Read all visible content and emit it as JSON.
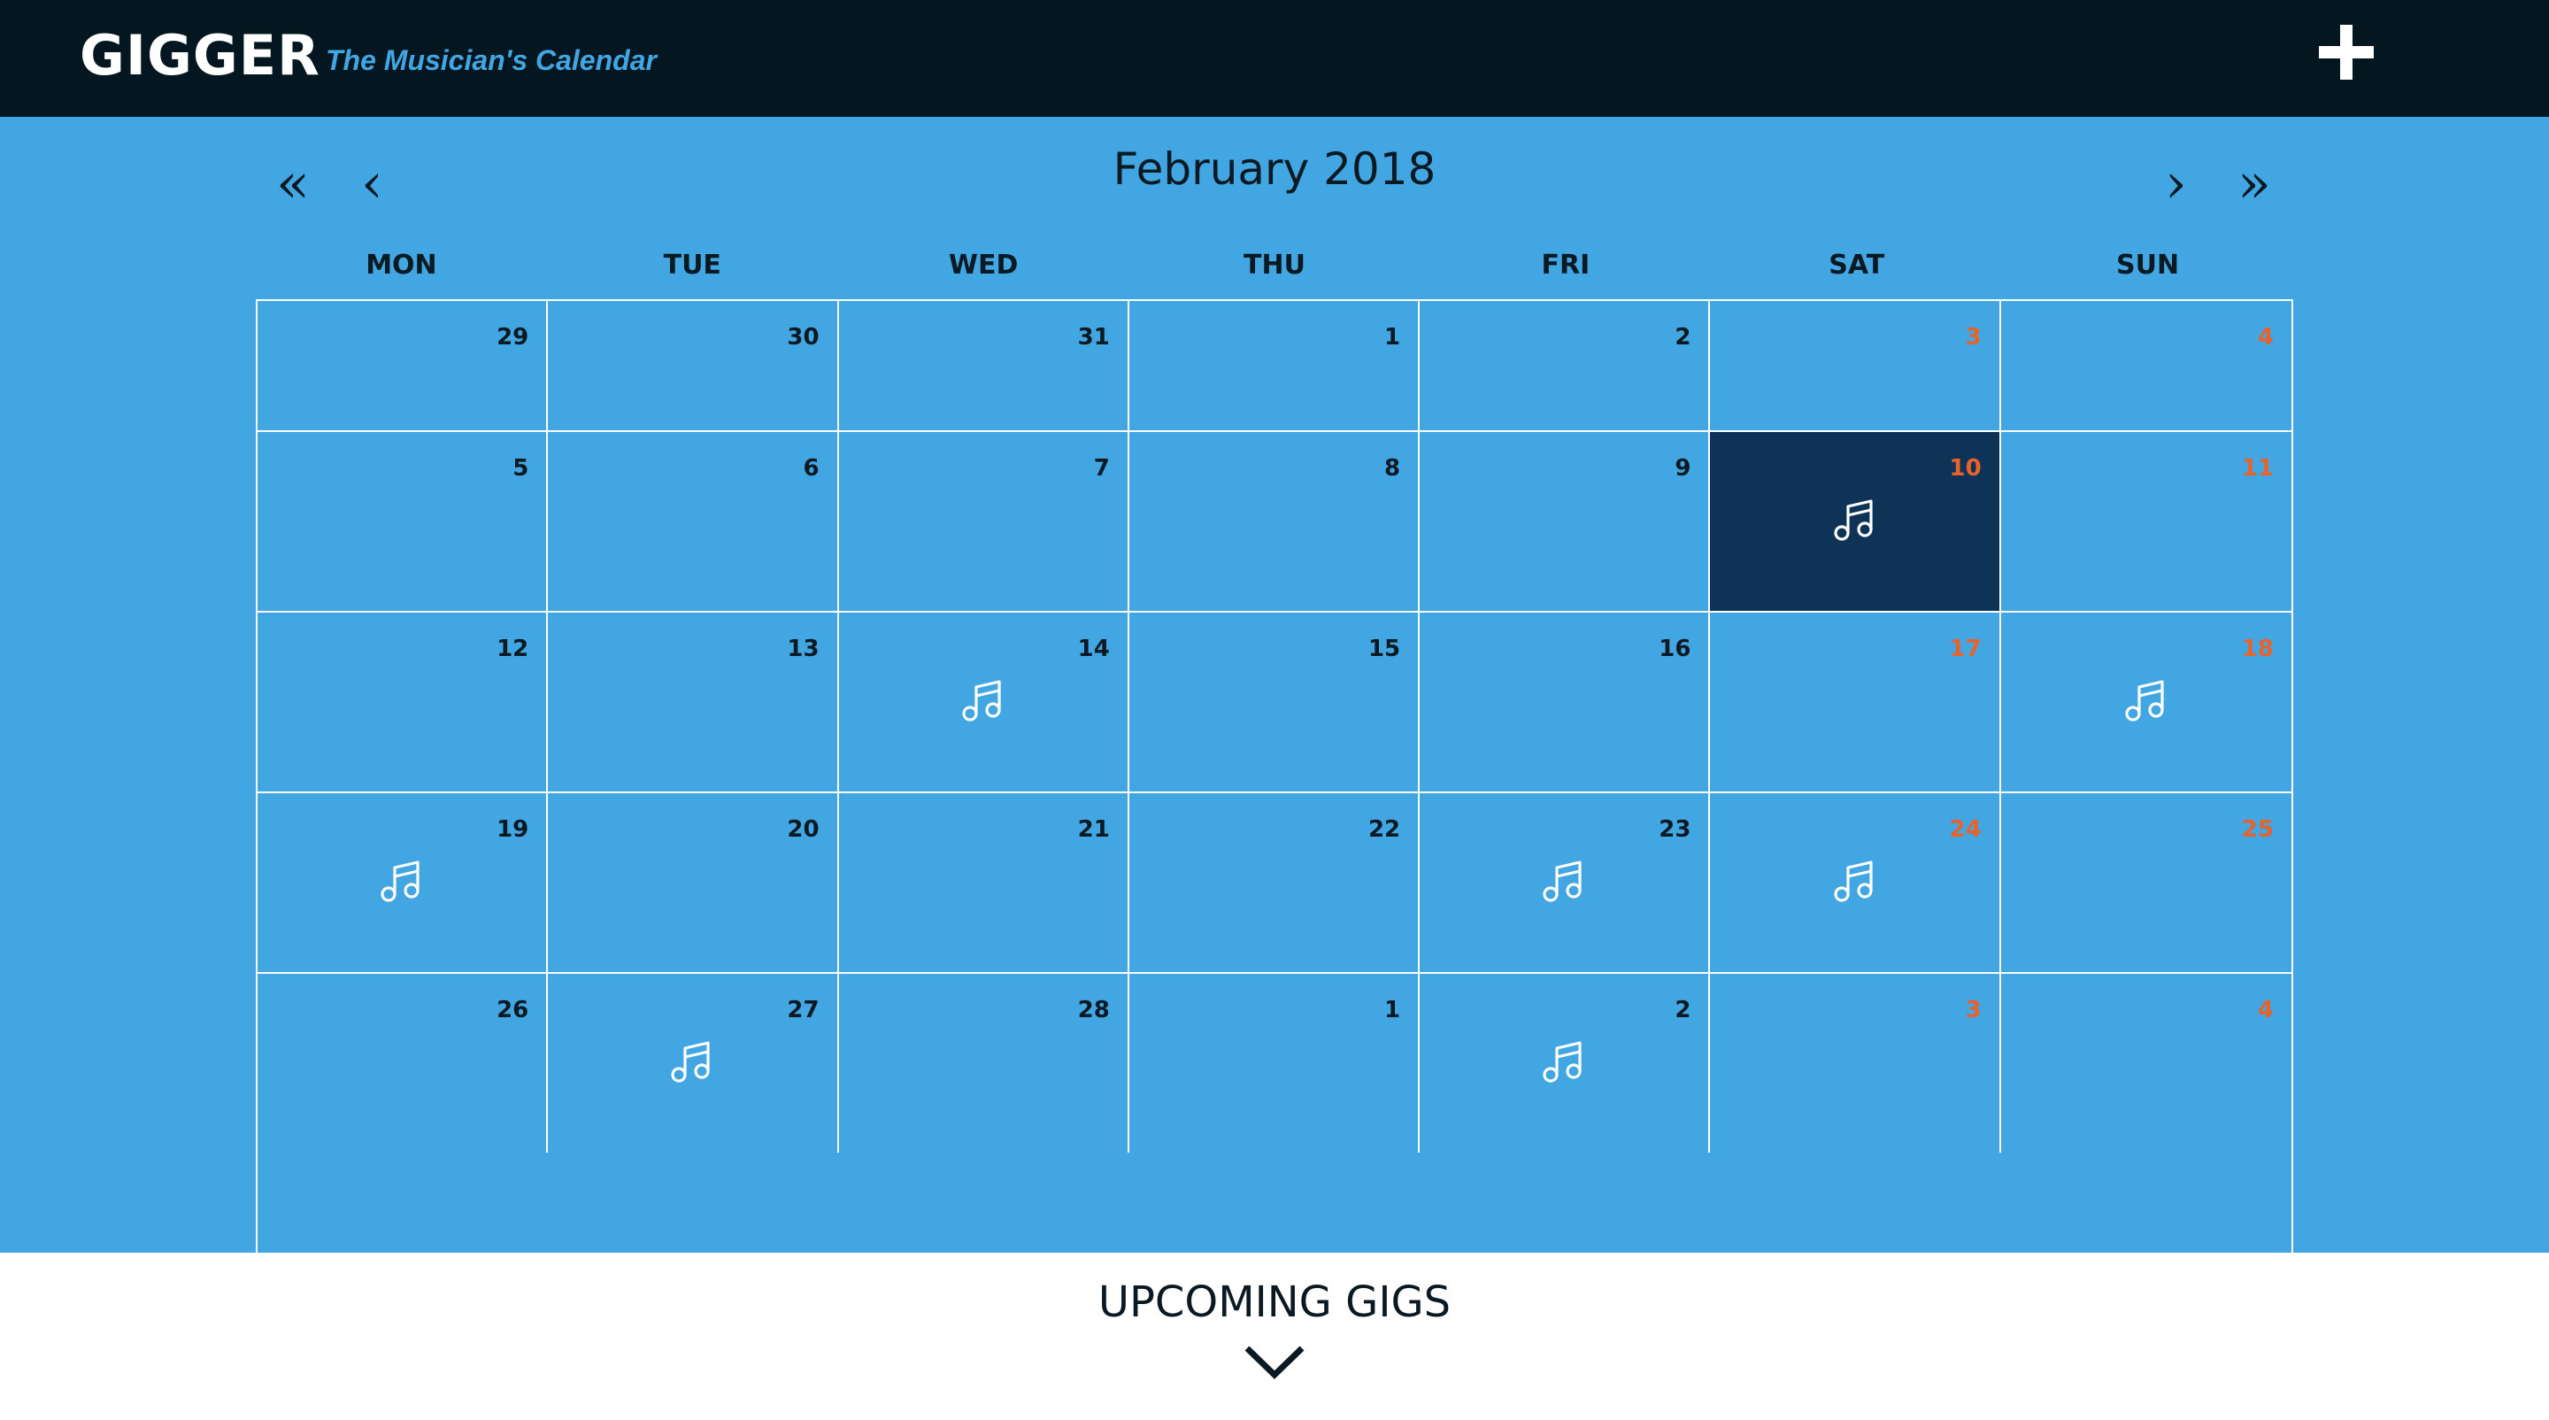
{
  "header": {
    "brand": "GIGGER",
    "tagline": "The Musician's Calendar",
    "add_icon": "plus-icon"
  },
  "calendar": {
    "title": "February 2018",
    "nav": {
      "prev_year": "«",
      "prev_month": "‹",
      "next_month": "›",
      "next_year": "»"
    },
    "weekdays": [
      "MON",
      "TUE",
      "WED",
      "THU",
      "FRI",
      "SAT",
      "SUN"
    ],
    "weeks": [
      [
        {
          "day": "29"
        },
        {
          "day": "30"
        },
        {
          "day": "31"
        },
        {
          "day": "1"
        },
        {
          "day": "2"
        },
        {
          "day": "3",
          "weekend": true
        },
        {
          "day": "4",
          "weekend": true
        }
      ],
      [
        {
          "day": "5"
        },
        {
          "day": "6"
        },
        {
          "day": "7"
        },
        {
          "day": "8"
        },
        {
          "day": "9"
        },
        {
          "day": "10",
          "weekend": true,
          "gig": true,
          "active": true
        },
        {
          "day": "11",
          "weekend": true
        }
      ],
      [
        {
          "day": "12"
        },
        {
          "day": "13"
        },
        {
          "day": "14",
          "gig": true
        },
        {
          "day": "15"
        },
        {
          "day": "16"
        },
        {
          "day": "17",
          "weekend": true
        },
        {
          "day": "18",
          "weekend": true,
          "gig": true
        }
      ],
      [
        {
          "day": "19",
          "gig": true
        },
        {
          "day": "20"
        },
        {
          "day": "21"
        },
        {
          "day": "22"
        },
        {
          "day": "23",
          "gig": true
        },
        {
          "day": "24",
          "weekend": true,
          "gig": true
        },
        {
          "day": "25",
          "weekend": true
        }
      ],
      [
        {
          "day": "26"
        },
        {
          "day": "27",
          "gig": true
        },
        {
          "day": "28"
        },
        {
          "day": "1"
        },
        {
          "day": "2",
          "gig": true
        },
        {
          "day": "3",
          "weekend": true
        },
        {
          "day": "4",
          "weekend": true
        }
      ]
    ],
    "gig_icon": "music-note-icon"
  },
  "upcoming": {
    "title": "UPCOMING GIGS",
    "toggle_icon": "chevron-down-icon"
  },
  "colors": {
    "header_bg": "#041720",
    "main_bg": "#42a6e3",
    "active_cell": "#0f3357",
    "weekend_text": "#e8632b",
    "tagline": "#42a6e3"
  }
}
